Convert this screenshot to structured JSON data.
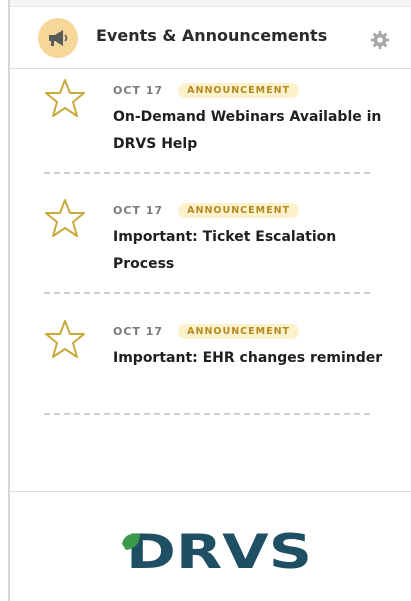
{
  "header": {
    "title": "Events & Announcements",
    "icon": "megaphone-icon",
    "settings_icon": "gear-icon"
  },
  "items": [
    {
      "date": "OCT 17",
      "badge": "ANNOUNCEMENT",
      "title": "On-Demand Webinars Available in DRVS Help",
      "starred": false
    },
    {
      "date": "OCT 17",
      "badge": "ANNOUNCEMENT",
      "title": "Important: Ticket Escalation Process",
      "starred": false
    },
    {
      "date": "OCT 17",
      "badge": "ANNOUNCEMENT",
      "title": "Important: EHR changes reminder",
      "starred": false
    }
  ],
  "footer": {
    "logo_text": "DRVS"
  },
  "colors": {
    "accent": "#f6d79a",
    "badge_bg": "#fbf1cb",
    "badge_text": "#b48a22",
    "star": "#c9a93a",
    "logo": "#1f4f63",
    "leaf": "#3b9a4a"
  }
}
